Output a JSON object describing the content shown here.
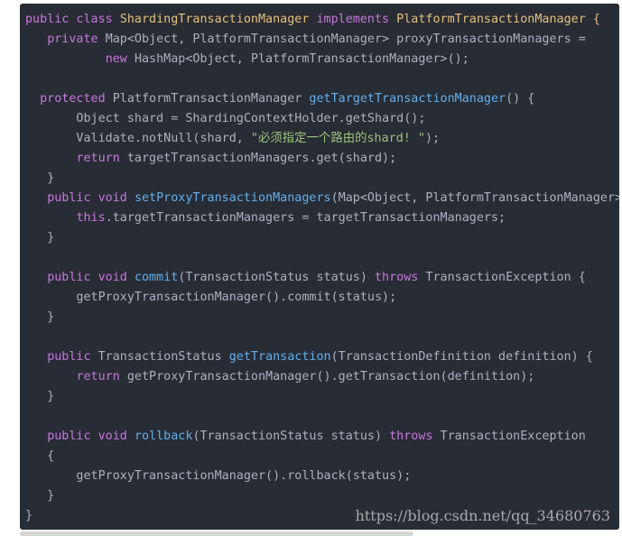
{
  "code_lines": [
    [
      [
        "kw",
        "public class "
      ],
      [
        "type",
        "ShardingTransactionManager "
      ],
      [
        "kw",
        "implements "
      ],
      [
        "type",
        "PlatformTransactionManager {"
      ]
    ],
    [
      [
        "plain",
        "   "
      ],
      [
        "kw",
        "private "
      ],
      [
        "plain",
        "Map<Object, PlatformTransactionManager> proxyTransactionManagers = "
      ]
    ],
    [
      [
        "plain",
        "           "
      ],
      [
        "kw",
        "new "
      ],
      [
        "plain",
        "HashMap<Object, PlatformTransactionManager>();"
      ]
    ],
    [],
    [
      [
        "plain",
        "  "
      ],
      [
        "kw",
        "protected "
      ],
      [
        "plain",
        "PlatformTransactionManager "
      ],
      [
        "fn",
        "getTargetTransactionManager"
      ],
      [
        "plain",
        "() {"
      ]
    ],
    [
      [
        "plain",
        "       Object shard = ShardingContextHolder.getShard();"
      ]
    ],
    [
      [
        "plain",
        "       Validate.notNull(shard, "
      ],
      [
        "str",
        "\"必须指定一个路由的shard! \""
      ],
      [
        "plain",
        ");"
      ]
    ],
    [
      [
        "plain",
        "       "
      ],
      [
        "kw",
        "return "
      ],
      [
        "plain",
        "targetTransactionManagers.get(shard);"
      ]
    ],
    [
      [
        "plain",
        "   }"
      ]
    ],
    [
      [
        "plain",
        "   "
      ],
      [
        "kw",
        "public void "
      ],
      [
        "fn",
        "setProxyTransactionManagers"
      ],
      [
        "plain",
        "(Map<Object, PlatformTransactionManager> targetTransactionManagers) {"
      ]
    ],
    [
      [
        "plain",
        "       "
      ],
      [
        "kw",
        "this"
      ],
      [
        "plain",
        ".targetTransactionManagers = targetTransactionManagers;"
      ]
    ],
    [
      [
        "plain",
        "   }"
      ]
    ],
    [],
    [
      [
        "plain",
        "   "
      ],
      [
        "kw",
        "public void "
      ],
      [
        "fn",
        "commit"
      ],
      [
        "plain",
        "(TransactionStatus status) "
      ],
      [
        "kw",
        "throws "
      ],
      [
        "plain",
        "TransactionException {"
      ]
    ],
    [
      [
        "plain",
        "       getProxyTransactionManager().commit(status);"
      ]
    ],
    [
      [
        "plain",
        "   }"
      ]
    ],
    [],
    [
      [
        "plain",
        "   "
      ],
      [
        "kw",
        "public "
      ],
      [
        "plain",
        "TransactionStatus "
      ],
      [
        "fn",
        "getTransaction"
      ],
      [
        "plain",
        "(TransactionDefinition definition) {"
      ]
    ],
    [
      [
        "plain",
        "       "
      ],
      [
        "kw",
        "return "
      ],
      [
        "plain",
        "getProxyTransactionManager().getTransaction(definition);"
      ]
    ],
    [
      [
        "plain",
        "   }"
      ]
    ],
    [],
    [
      [
        "plain",
        "   "
      ],
      [
        "kw",
        "public void "
      ],
      [
        "fn",
        "rollback"
      ],
      [
        "plain",
        "(TransactionStatus status) "
      ],
      [
        "kw",
        "throws "
      ],
      [
        "plain",
        "TransactionException"
      ]
    ],
    [
      [
        "plain",
        "   {"
      ]
    ],
    [
      [
        "plain",
        "       getProxyTransactionManager().rollback(status);"
      ]
    ],
    [
      [
        "plain",
        "   }"
      ]
    ],
    [
      [
        "plain",
        "}"
      ]
    ]
  ],
  "watermark": "https://blog.csdn.net/qq_34680763",
  "colors": {
    "background": "#282c34",
    "keyword": "#c678dd",
    "type": "#e5c07b",
    "function": "#61afef",
    "string": "#98c379",
    "text": "#abb2bf"
  }
}
